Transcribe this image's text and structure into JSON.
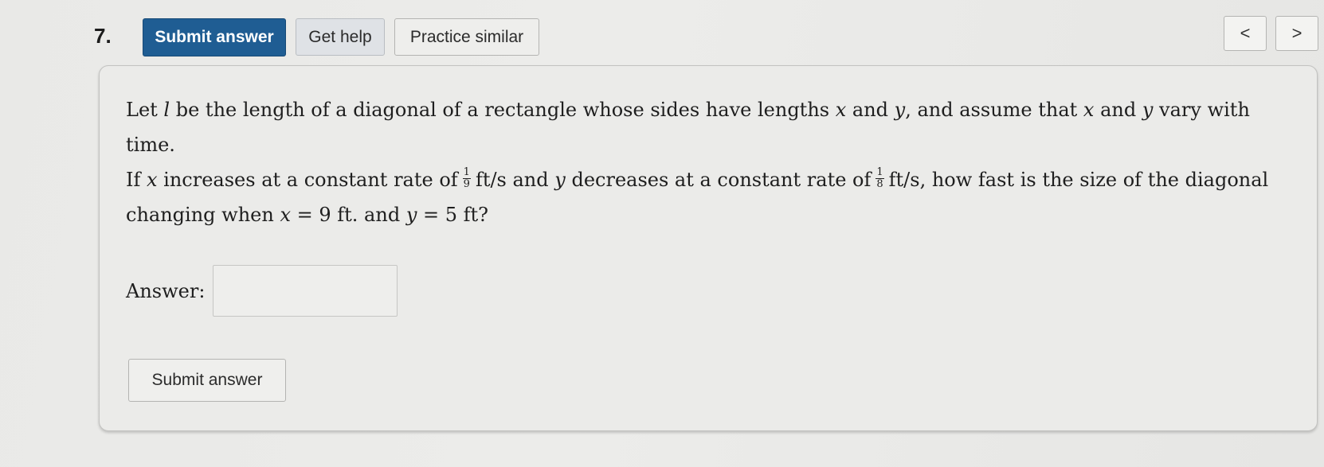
{
  "question": {
    "number": "7."
  },
  "toolbar": {
    "submit_label": "Submit answer",
    "help_label": "Get help",
    "similar_label": "Practice similar",
    "prev_label": "<",
    "next_label": ">"
  },
  "problem": {
    "l1_a": "Let ",
    "l1_l": "l",
    "l1_b": " be the length of a diagonal of a rectangle whose sides have lengths ",
    "l1_x": "x",
    "l1_c": " and ",
    "l1_y": "y",
    "l1_d": ", and assume that ",
    "l1_x2": "x",
    "l1_e": " and ",
    "l1_y2": "y",
    "l1_f": " vary with",
    "l2": "time.",
    "l3_a": "If ",
    "l3_x": "x",
    "l3_b": " increases at a constant rate of",
    "frac1_num": "1",
    "frac1_den": "9",
    "l3_c": "ft/s and ",
    "l3_y": "y",
    "l3_d": " decreases at a constant rate of",
    "frac2_num": "1",
    "frac2_den": "8",
    "l3_e": "ft/s, how fast is the size of the diagonal",
    "l4_a": "changing when ",
    "l4_x": "x",
    "l4_b": " = 9  ft. and ",
    "l4_y": "y",
    "l4_c": " = 5  ft?"
  },
  "answer": {
    "label": "Answer:",
    "value": "",
    "icon": "pencil-icon"
  },
  "footer": {
    "submit_label": "Submit answer"
  },
  "colors": {
    "primary": "#1f5d93",
    "background": "#ebebe9"
  }
}
